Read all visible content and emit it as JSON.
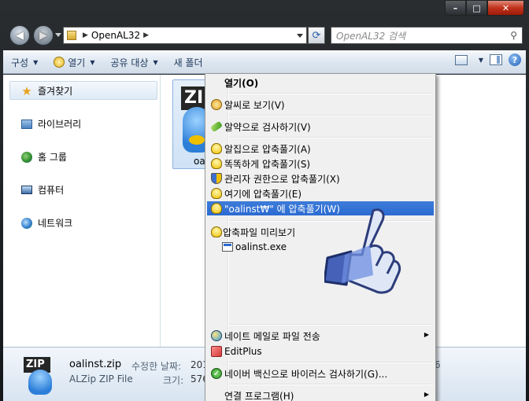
{
  "window": {
    "caption_buttons": {
      "minimize": "–",
      "maximize": "□",
      "close": "✕"
    }
  },
  "navbar": {
    "back_icon": "arrow-left",
    "forward_icon": "arrow-right",
    "address_path": "OpenAL32",
    "search_placeholder": "OpenAL32 검색"
  },
  "toolbar": {
    "organize": "구성",
    "open": "열기",
    "share": "공유 대상",
    "new_folder": "새 폴더"
  },
  "sidebar": {
    "favorites": "즐겨찾기",
    "libraries": "라이브러리",
    "homegroup": "홈 그룹",
    "computer": "컴퓨터",
    "network": "네트워크"
  },
  "files": [
    {
      "name": "oal",
      "icon_badge": "ZIP"
    }
  ],
  "details": {
    "icon_badge": "ZIP",
    "file_name": "oalinst.zip",
    "file_type": "ALZip ZIP File",
    "modified_label": "수정한 날짜:",
    "modified_value": "201",
    "size_label": "크기:",
    "size_value": "576",
    "right_fragment": "6"
  },
  "context_menu": {
    "items": [
      {
        "label": "열기(O)",
        "bold": true
      },
      {
        "label": "알씨로 보기(V)"
      },
      {
        "label": "알약으로 검사하기(V)"
      },
      {
        "label": "알집으로 압축풀기(A)"
      },
      {
        "label": "똑똑하게 압축풀기(S)"
      },
      {
        "label": "관리자 권한으로 압축풀기(X)"
      },
      {
        "label": "여기에 압축풀기(E)"
      },
      {
        "label": "\"oalinst₩\" 에 압축풀기(W)",
        "highlighted": true
      },
      {
        "label": "압축파일 미리보기"
      },
      {
        "label": "oalinst.exe"
      },
      {
        "label": "네이트 메일로 파일 전송",
        "submenu": true
      },
      {
        "label": "EditPlus"
      },
      {
        "label": "네이버 백신으로 바이러스 검사하기(G)..."
      },
      {
        "label": "연결 프로그램(H)",
        "submenu": true
      }
    ]
  },
  "colors": {
    "highlight": "#2c6bd2",
    "toolbar_text": "#1e395b",
    "title_bar": "#14181b"
  }
}
